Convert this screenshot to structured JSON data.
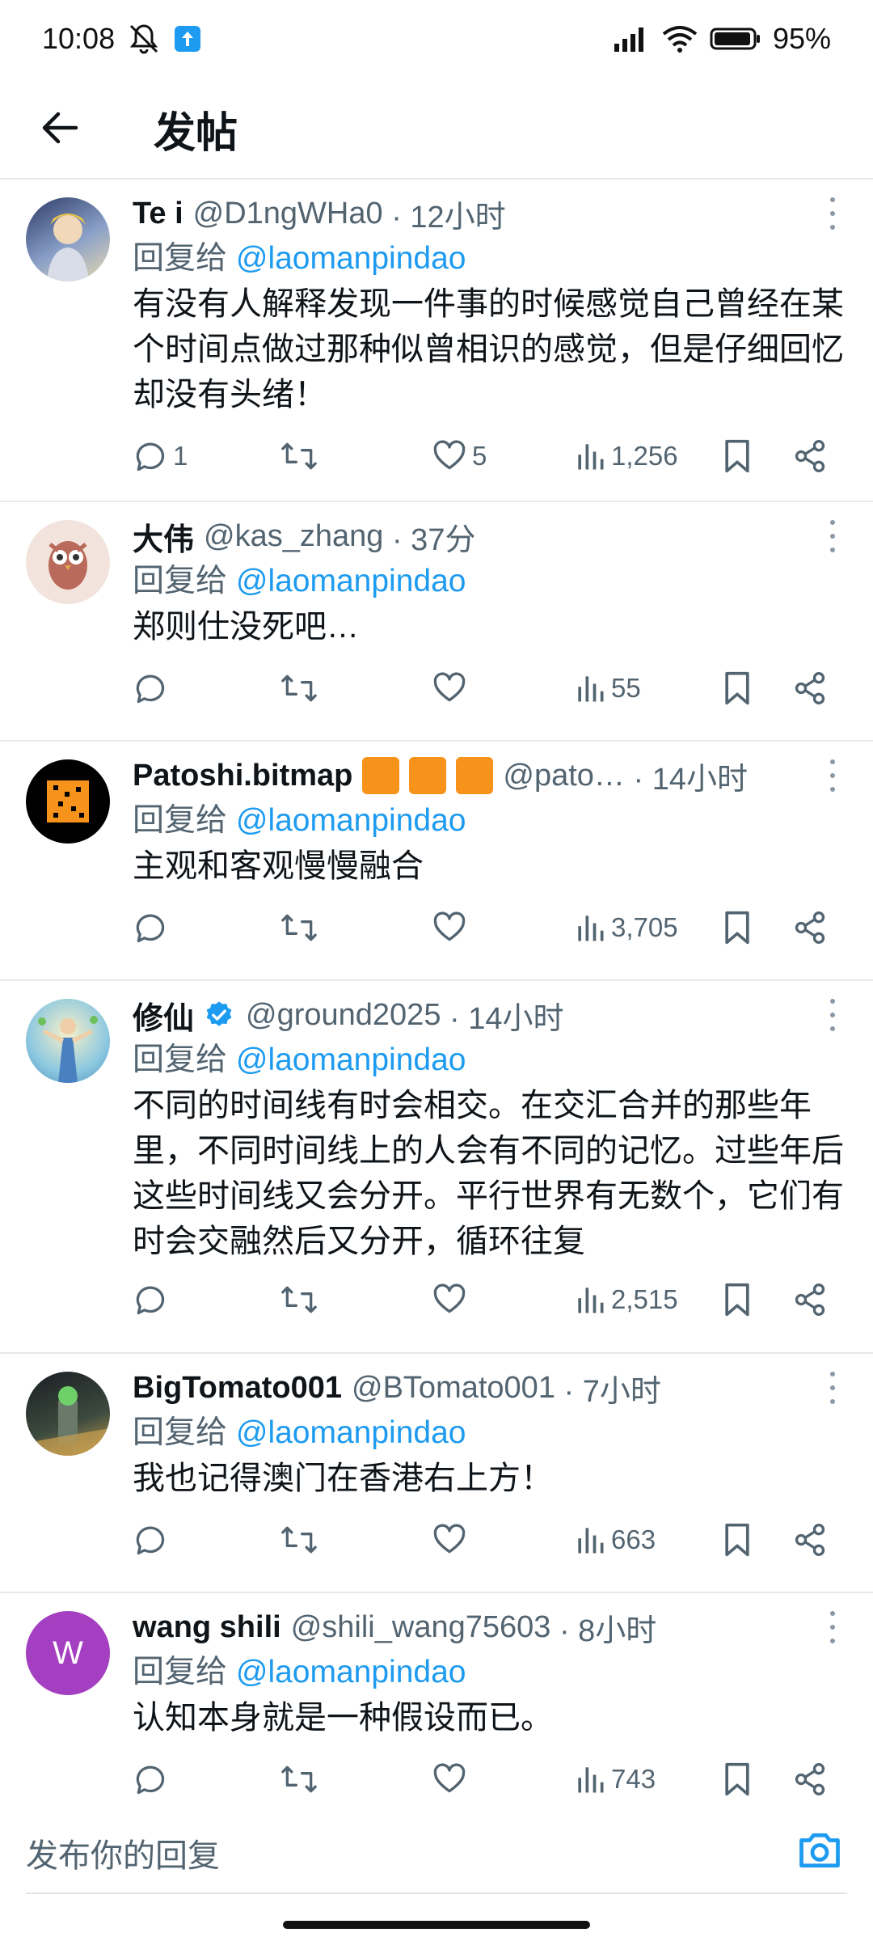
{
  "status": {
    "time": "10:08",
    "battery": "95%"
  },
  "header": {
    "title": "发帖"
  },
  "posts": [
    {
      "name": "Te i",
      "handle": "@D1ngWHa0",
      "time": "· 12小时",
      "reply_label": "回复给",
      "reply_to": "@laomanpindao",
      "text": "有没有人解释发现一件事的时候感觉自己曾经在某个时间点做过那种似曾相识的感觉，但是仔细回忆却没有头绪！",
      "replies": "1",
      "retweets": "",
      "likes": "5",
      "views": "1,256"
    },
    {
      "name": "大伟",
      "handle": "@kas_zhang",
      "time": "· 37分",
      "reply_label": "回复给",
      "reply_to": "@laomanpindao",
      "text": "郑则仕没死吧…",
      "replies": "",
      "retweets": "",
      "likes": "",
      "views": "55"
    },
    {
      "name": "Patoshi.bitmap",
      "handle": "@pato…",
      "time": "· 14小时",
      "reply_label": "回复给",
      "reply_to": "@laomanpindao",
      "text": "主观和客观慢慢融合",
      "replies": "",
      "retweets": "",
      "likes": "",
      "views": "3,705"
    },
    {
      "name": "修仙",
      "handle": "@ground2025",
      "time": "· 14小时",
      "reply_label": "回复给",
      "reply_to": "@laomanpindao",
      "text": "不同的时间线有时会相交。在交汇合并的那些年里，不同时间线上的人会有不同的记忆。过些年后这些时间线又会分开。平行世界有无数个，它们有时会交融然后又分开，循环往复",
      "replies": "",
      "retweets": "",
      "likes": "",
      "views": "2,515"
    },
    {
      "name": "BigTomato001",
      "handle": "@BTomato001",
      "time": "· 7小时",
      "reply_label": "回复给",
      "reply_to": "@laomanpindao",
      "text": "我也记得澳门在香港右上方！",
      "replies": "",
      "retweets": "",
      "likes": "",
      "views": "663"
    },
    {
      "name": "wang shili",
      "handle": "@shili_wang75603",
      "time": "· 8小时",
      "reply_label": "回复给",
      "reply_to": "@laomanpindao",
      "text": "认知本身就是一种假设而已。",
      "replies": "",
      "retweets": "",
      "likes": "",
      "views": "743",
      "avatar_letter": "W"
    }
  ],
  "composer": {
    "placeholder": "发布你的回复"
  },
  "colors": {
    "accent": "#1d9bf0",
    "text": "#0f1419",
    "muted": "#536471",
    "bitcoin_orange": "#f7931a",
    "avatar_purple": "#a33fc0"
  }
}
